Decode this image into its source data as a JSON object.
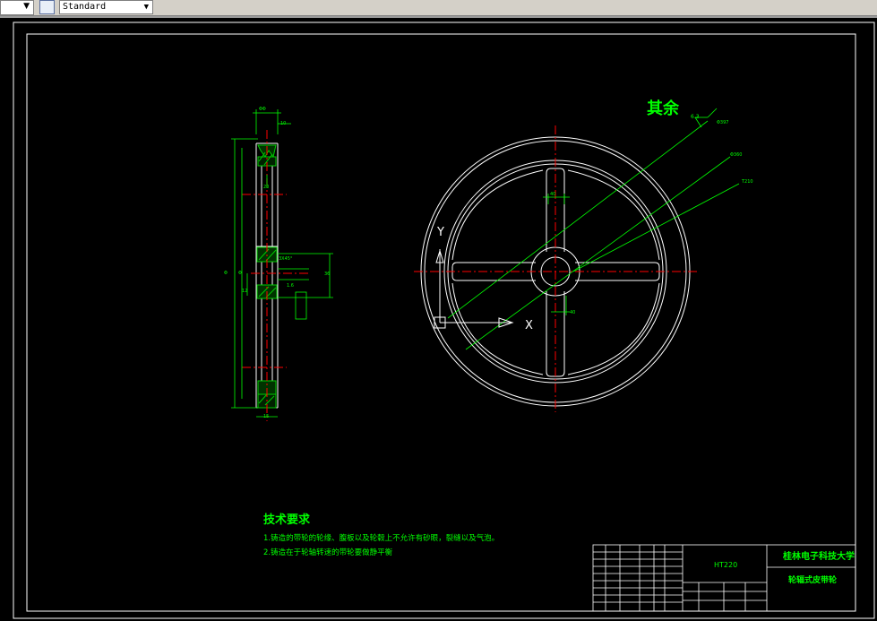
{
  "toolbar": {
    "text_style": "Standard"
  },
  "drawing": {
    "roughness_label": "其余",
    "roughness_value": "6.3",
    "tech_title": "技术要求",
    "tech_lines": [
      "1.铸造的带轮的轮缘、腹板以及轮毂上不允许有砂眼，裂缝以及气泡。",
      "2.铸造在于轮轴转速的带轮要做静平衡"
    ],
    "axis_x": "X",
    "axis_y": "Y",
    "title_block": {
      "material": "HT220",
      "school": "桂林电子科技大学",
      "part_name": "轮辐式皮带轮"
    }
  },
  "colors": {
    "outline": "#ffffff",
    "dimension": "#00ff00",
    "centerline": "#ff0000",
    "text_green": "#00ff00",
    "hatch": "#00cc00"
  }
}
